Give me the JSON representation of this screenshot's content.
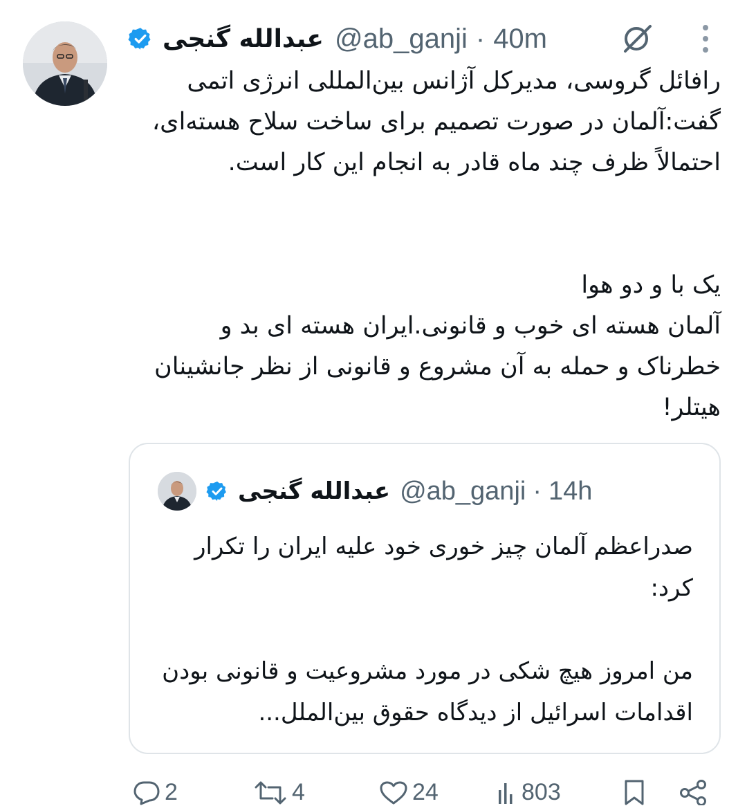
{
  "post": {
    "author_name": "عبدالله گنجی",
    "handle": "@ab_ganji",
    "separator": "·",
    "time": "40m",
    "verified_color": "#1d9bf0",
    "paragraphs": [
      "رافائل گروسی، مدیرکل آژانس بین‌المللی انرژی اتمی گفت:آلمان در صورت تصمیم برای ساخت سلاح هسته‌ای، احتمالاً ظرف چند ماه قادر به انجام این کار است.",
      "یک با و دو هوا",
      "آلمان هسته ای خوب و قانونی.ایران هسته ای بد و خطرناک  و حمله به آن مشروع و قانونی از نظر جانشینان هیتلر!"
    ]
  },
  "quoted": {
    "author_name": "عبدالله گنجی",
    "handle": "@ab_ganji",
    "separator": "·",
    "time": "14h",
    "paragraphs": [
      "صدراعظم آلمان چیز خوری خود علیه ایران را تکرار کرد:",
      "من امروز هیچ شکی در مورد مشروعیت و قانونی بودن اقدامات اسرائیل از دیدگاه حقوق بین‌الملل..."
    ]
  },
  "actions": {
    "replies": "2",
    "reposts": "4",
    "likes": "24",
    "views": "803"
  },
  "icons": {
    "grok": "grok-icon",
    "more": "more-dots-icon",
    "reply": "reply-icon",
    "repost": "repost-icon",
    "like": "heart-icon",
    "views": "views-chart-icon",
    "bookmark": "bookmark-icon",
    "share": "share-icon"
  },
  "colors": {
    "text": "#0f1419",
    "secondary": "#536471",
    "border": "#dfe4e8",
    "verified": "#1d9bf0"
  }
}
